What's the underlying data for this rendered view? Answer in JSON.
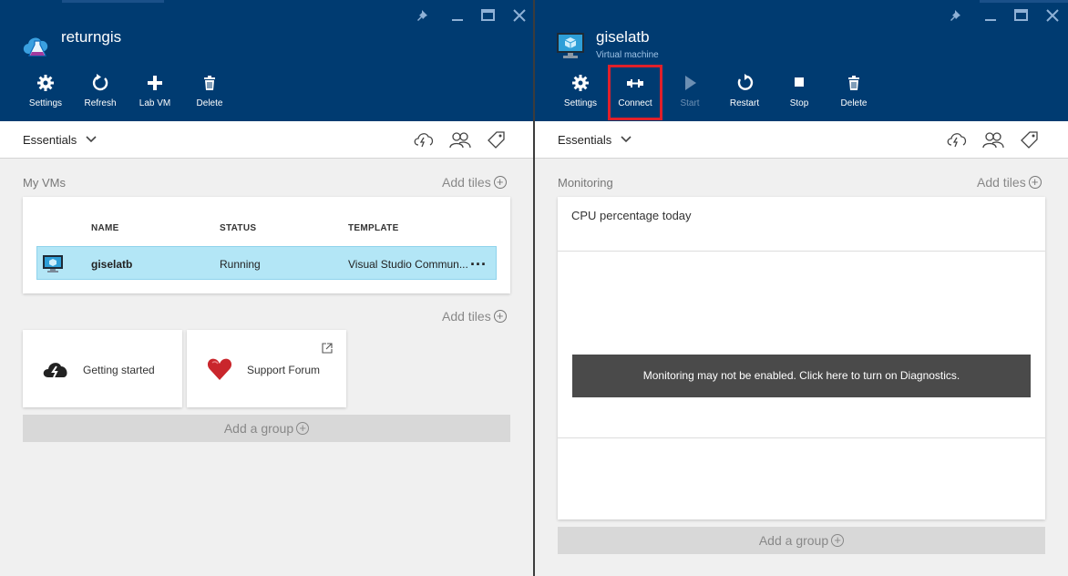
{
  "left_blade": {
    "title": "returngis",
    "commands": [
      {
        "label": "Settings",
        "icon": "gear-icon"
      },
      {
        "label": "Refresh",
        "icon": "refresh-icon"
      },
      {
        "label": "Lab VM",
        "icon": "plus-icon"
      },
      {
        "label": "Delete",
        "icon": "trash-icon"
      }
    ],
    "essentials_label": "Essentials",
    "my_vms_label": "My VMs",
    "add_tiles_label": "Add tiles",
    "table": {
      "columns": [
        "NAME",
        "STATUS",
        "TEMPLATE"
      ],
      "rows": [
        {
          "name": "giselatb",
          "status": "Running",
          "template": "Visual Studio Commun...",
          "more": "..."
        }
      ]
    },
    "add_tiles_label_2": "Add tiles",
    "tiles": [
      {
        "label": "Getting started",
        "icon": "cloud-lightning-icon"
      },
      {
        "label": "Support Forum",
        "icon": "heart-icon"
      }
    ],
    "add_group_label": "Add a group"
  },
  "right_blade": {
    "title": "giselatb",
    "subtitle": "Virtual machine",
    "commands": [
      {
        "label": "Settings",
        "icon": "gear-icon",
        "enabled": true
      },
      {
        "label": "Connect",
        "icon": "connect-icon",
        "enabled": true,
        "highlighted": true
      },
      {
        "label": "Start",
        "icon": "play-icon",
        "enabled": false
      },
      {
        "label": "Restart",
        "icon": "restart-icon",
        "enabled": true
      },
      {
        "label": "Stop",
        "icon": "stop-icon",
        "enabled": true
      },
      {
        "label": "Delete",
        "icon": "trash-icon",
        "enabled": true
      }
    ],
    "essentials_label": "Essentials",
    "monitoring_label": "Monitoring",
    "add_tiles_label": "Add tiles",
    "monitor_card_title": "CPU percentage today",
    "diagnostics_message": "Monitoring may not be enabled. Click here to turn on Diagnostics.",
    "add_group_label": "Add a group"
  },
  "colors": {
    "header_bg": "#003b71",
    "highlight_border": "#e0202a",
    "selected_row_bg": "#b3e6f6",
    "banner_bg": "#4a4a4a"
  }
}
